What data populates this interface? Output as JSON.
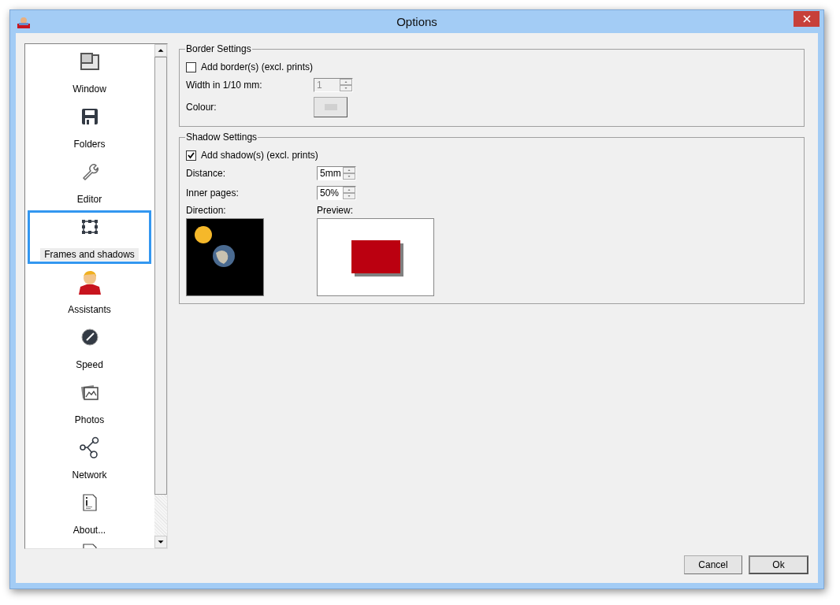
{
  "window": {
    "title": "Options"
  },
  "sidebar": {
    "items": [
      {
        "label": "Window",
        "selected": false
      },
      {
        "label": "Folders",
        "selected": false
      },
      {
        "label": "Editor",
        "selected": false
      },
      {
        "label": "Frames and shadows",
        "selected": true
      },
      {
        "label": "Assistants",
        "selected": false
      },
      {
        "label": "Speed",
        "selected": false
      },
      {
        "label": "Photos",
        "selected": false
      },
      {
        "label": "Network",
        "selected": false
      },
      {
        "label": "About...",
        "selected": false
      }
    ]
  },
  "border_settings": {
    "title": "Border Settings",
    "add_border": {
      "label": "Add border(s) (excl. prints)",
      "checked": false
    },
    "width": {
      "label": "Width in 1/10 mm:",
      "value": "1",
      "disabled": true
    },
    "colour": {
      "label": "Colour:",
      "disabled": true
    }
  },
  "shadow_settings": {
    "title": "Shadow Settings",
    "add_shadow": {
      "label": "Add shadow(s) (excl. prints)",
      "checked": true
    },
    "distance": {
      "label": "Distance:",
      "value": "5mm",
      "disabled": false
    },
    "inner_pages": {
      "label": "Inner pages:",
      "value": "50%",
      "disabled": false
    },
    "direction": {
      "label": "Direction:"
    },
    "preview": {
      "label": "Preview:"
    }
  },
  "buttons": [
    {
      "label": "Cancel",
      "default": false
    },
    {
      "label": "Ok",
      "default": true
    }
  ]
}
